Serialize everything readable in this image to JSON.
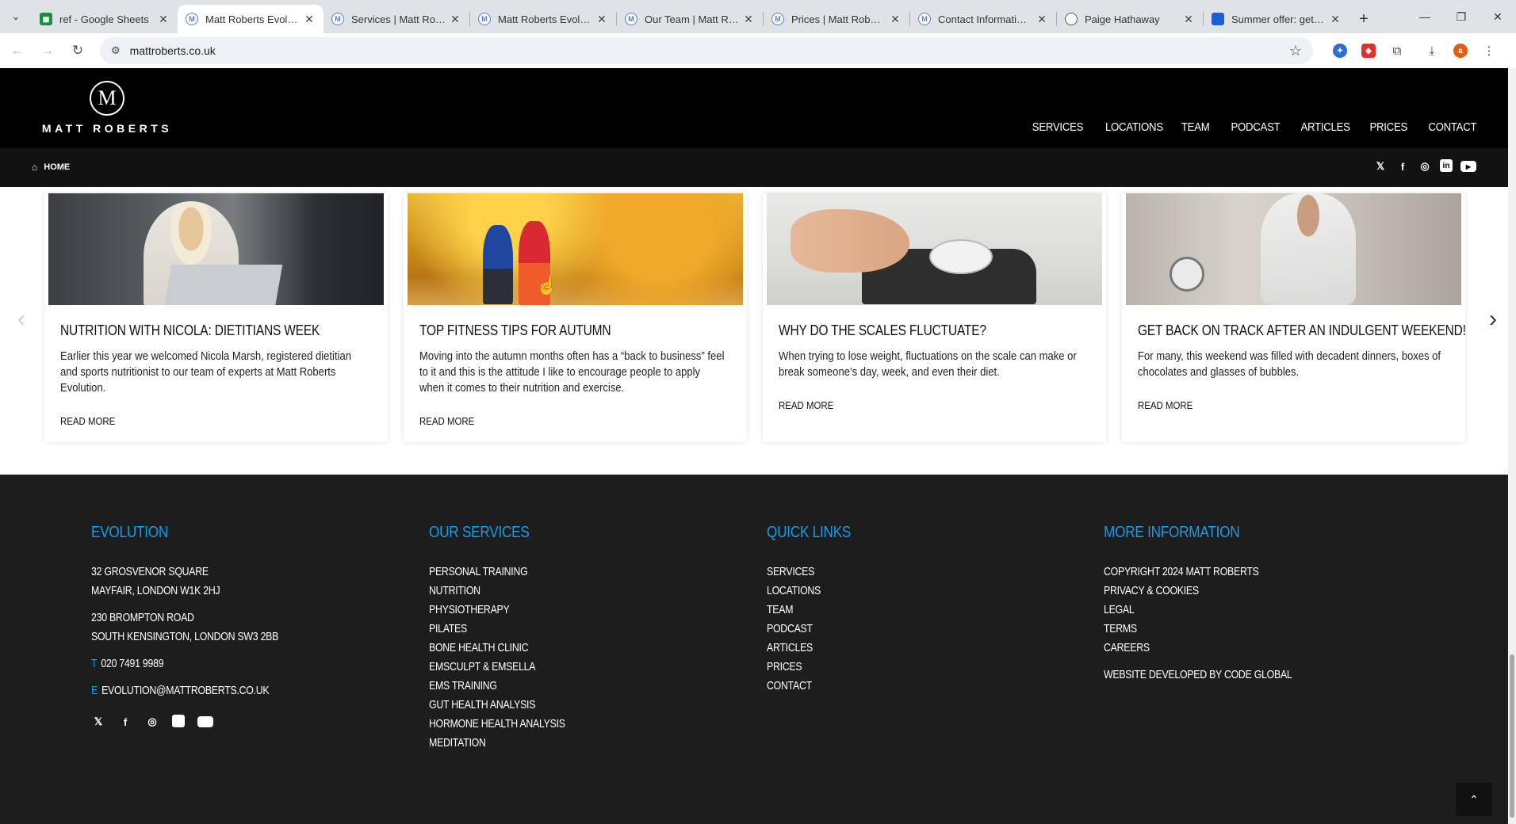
{
  "browser": {
    "tabs": [
      {
        "title": "ref - Google Sheets",
        "icon": "sheets-icon"
      },
      {
        "title": "Matt Roberts Evolution",
        "icon": "matt-roberts-icon",
        "active": true
      },
      {
        "title": "Services | Matt Roberts",
        "icon": "matt-roberts-icon"
      },
      {
        "title": "Matt Roberts Evolution",
        "icon": "matt-roberts-icon"
      },
      {
        "title": "Our Team | Matt Roberts",
        "icon": "matt-roberts-icon"
      },
      {
        "title": "Prices | Matt Roberts",
        "icon": "matt-roberts-icon"
      },
      {
        "title": "Contact Information |",
        "icon": "matt-roberts-icon"
      },
      {
        "title": "Paige Hathaway",
        "icon": "globe-icon"
      },
      {
        "title": "Summer offer: get on",
        "icon": "app-icon"
      }
    ],
    "url": "mattroberts.co.uk",
    "profile_initial": "a"
  },
  "site": {
    "logo_letter": "M",
    "logo_text": "MATT ROBERTS",
    "nav": [
      "SERVICES",
      "LOCATIONS",
      "TEAM",
      "PODCAST",
      "ARTICLES",
      "PRICES",
      "CONTACT"
    ],
    "breadcrumb_home": "HOME"
  },
  "articles": [
    {
      "title": "NUTRITION WITH NICOLA: DIETITIANS WEEK",
      "excerpt": "Earlier this year we welcomed Nicola Marsh, registered dietitian and sports nutritionist to our team of experts at Matt Roberts Evolution.",
      "read_more": "READ MORE"
    },
    {
      "title": "TOP FITNESS TIPS FOR AUTUMN",
      "excerpt": "Moving into the autumn months often has a “back to business” feel to it and this is the attitude I like to encourage people to apply when it comes to their nutrition and exercise.",
      "read_more": "READ MORE"
    },
    {
      "title": "WHY DO THE SCALES FLUCTUATE?",
      "excerpt": "When trying to lose weight, fluctuations on the scale can make or break someone’s day, week, and even their diet.",
      "read_more": "READ MORE"
    },
    {
      "title": "GET BACK ON TRACK AFTER AN INDULGENT WEEKEND!",
      "excerpt": "For many, this weekend was filled with decadent dinners, boxes of chocolates and glasses of bubbles.",
      "read_more": "READ MORE"
    }
  ],
  "footer": {
    "evolution": {
      "heading": "EVOLUTION",
      "address1": [
        "32 GROSVENOR SQUARE",
        "MAYFAIR, LONDON W1K 2HJ"
      ],
      "address2": [
        "230 BROMPTON ROAD",
        "SOUTH KENSINGTON, LONDON SW3 2BB"
      ],
      "phone_label": "T",
      "phone": "020 7491 9989",
      "email_label": "E",
      "email": "EVOLUTION@MATTROBERTS.CO.UK"
    },
    "services": {
      "heading": "OUR SERVICES",
      "items": [
        "PERSONAL TRAINING",
        "NUTRITION",
        "PHYSIOTHERAPY",
        "PILATES",
        "BONE HEALTH CLINIC",
        "EMSCULPT & EMSELLA",
        "EMS TRAINING",
        "GUT HEALTH ANALYSIS",
        "HORMONE HEALTH ANALYSIS",
        "MEDITATION"
      ]
    },
    "quick_links": {
      "heading": "QUICK LINKS",
      "items": [
        "SERVICES",
        "LOCATIONS",
        "TEAM",
        "PODCAST",
        "ARTICLES",
        "PRICES",
        "CONTACT"
      ]
    },
    "more_info": {
      "heading": "MORE INFORMATION",
      "items": [
        "COPYRIGHT 2024 MATT ROBERTS",
        "PRIVACY & COOKIES",
        "LEGAL",
        "TERMS",
        "CAREERS"
      ],
      "developer": "WEBSITE DEVELOPED BY CODE GLOBAL"
    }
  },
  "colors": {
    "accent_blue": "#1c9be6",
    "header_bg": "#000000",
    "footer_bg": "#1d1d1d"
  }
}
